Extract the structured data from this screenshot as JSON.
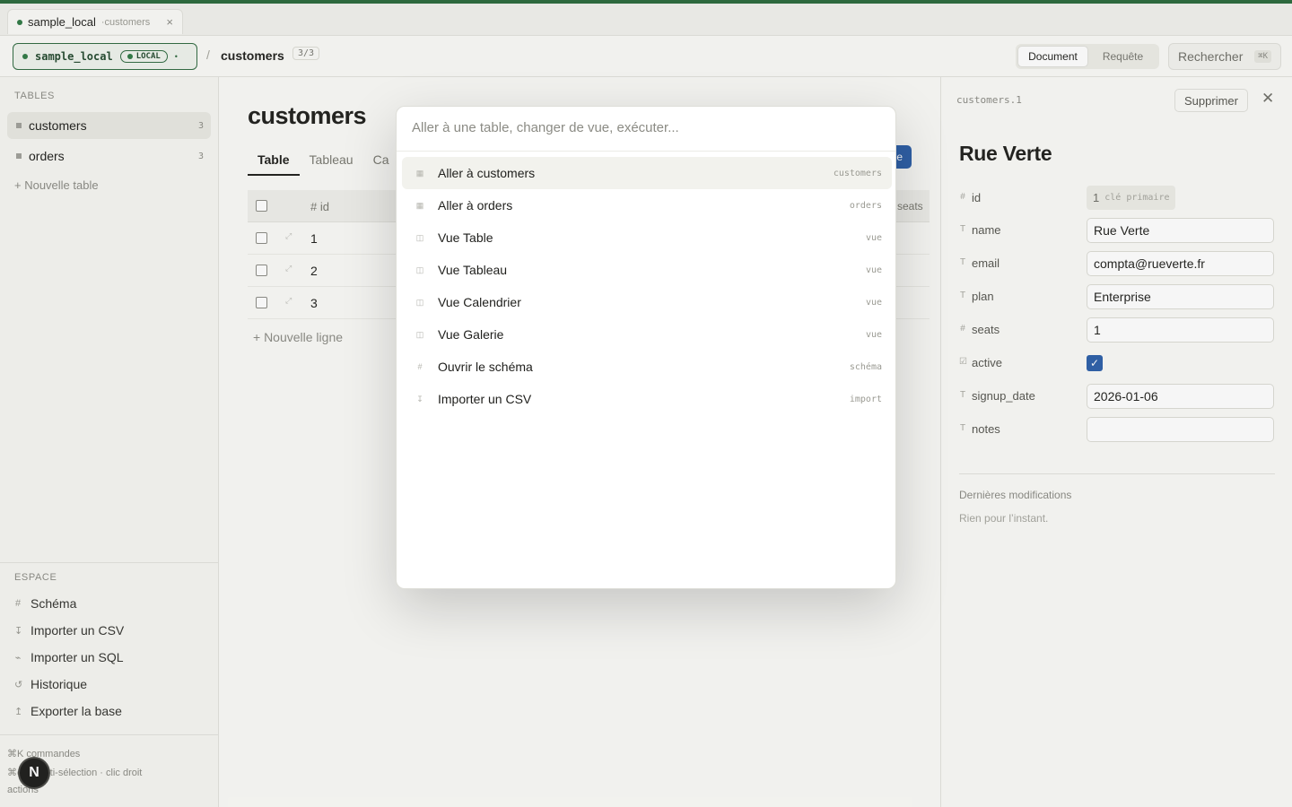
{
  "tab": {
    "db": "sample_local",
    "sub": "customers",
    "close": "×"
  },
  "toolbar": {
    "db_name": "sample_local",
    "badge": "LOCAL",
    "caret": "•",
    "sep": "/",
    "crumb": "customers",
    "count": "3/3",
    "mode_document": "Document",
    "mode_query": "Requête",
    "search_label": "Rechercher",
    "search_kbd": "⌘K"
  },
  "sidebar": {
    "tables_head": "TABLES",
    "tables": [
      {
        "label": "customers",
        "count": "3"
      },
      {
        "label": "orders",
        "count": "3"
      }
    ],
    "new_table": "+ Nouvelle table",
    "space_head": "ESPACE",
    "space_items": [
      {
        "icon": "#",
        "label": "Schéma"
      },
      {
        "icon": "↧",
        "label": "Importer un CSV"
      },
      {
        "icon": "⌁",
        "label": "Importer un SQL"
      },
      {
        "icon": "↺",
        "label": "Historique"
      },
      {
        "icon": "↥",
        "label": "Exporter la base"
      }
    ],
    "hint1": "⌘K commandes",
    "hint2": "⌘clic multi-sélection · clic droit",
    "hint3": "actions",
    "avatar": "N"
  },
  "main": {
    "title": "customers",
    "tabs": [
      "Table",
      "Tableau",
      "Ca"
    ],
    "new_btn": "e",
    "col_id": "# id",
    "col_seats": "seats",
    "rows": [
      "1",
      "2",
      "3"
    ],
    "new_row": "+ Nouvelle ligne"
  },
  "palette": {
    "placeholder": "Aller à une table, changer de vue, exécuter...",
    "items": [
      {
        "icon": "▦",
        "label": "Aller à customers",
        "kind": "customers"
      },
      {
        "icon": "▦",
        "label": "Aller à orders",
        "kind": "orders"
      },
      {
        "icon": "◫",
        "label": "Vue Table",
        "kind": "vue"
      },
      {
        "icon": "◫",
        "label": "Vue Tableau",
        "kind": "vue"
      },
      {
        "icon": "◫",
        "label": "Vue Calendrier",
        "kind": "vue"
      },
      {
        "icon": "◫",
        "label": "Vue Galerie",
        "kind": "vue"
      },
      {
        "icon": "#",
        "label": "Ouvrir le schéma",
        "kind": "schéma"
      },
      {
        "icon": "↧",
        "label": "Importer un CSV",
        "kind": "import"
      }
    ]
  },
  "detail": {
    "ref": "customers.1",
    "delete": "Supprimer",
    "close": "✕",
    "title": "Rue Verte",
    "pk_value": "1",
    "pk_label": "clé primaire",
    "fields": [
      {
        "type": "#",
        "label": "id"
      },
      {
        "type": "T",
        "label": "name",
        "value": "Rue Verte"
      },
      {
        "type": "T",
        "label": "email",
        "value": "compta@rueverte.fr"
      },
      {
        "type": "T",
        "label": "plan",
        "value": "Enterprise"
      },
      {
        "type": "#",
        "label": "seats",
        "value": "1"
      },
      {
        "type": "☑",
        "label": "active",
        "check": "✓"
      },
      {
        "type": "T",
        "label": "signup_date",
        "value": "2026-01-06"
      },
      {
        "type": "T",
        "label": "notes",
        "value": ""
      }
    ],
    "recent_head": "Dernières modifications",
    "recent_none": "Rien pour l’instant."
  }
}
